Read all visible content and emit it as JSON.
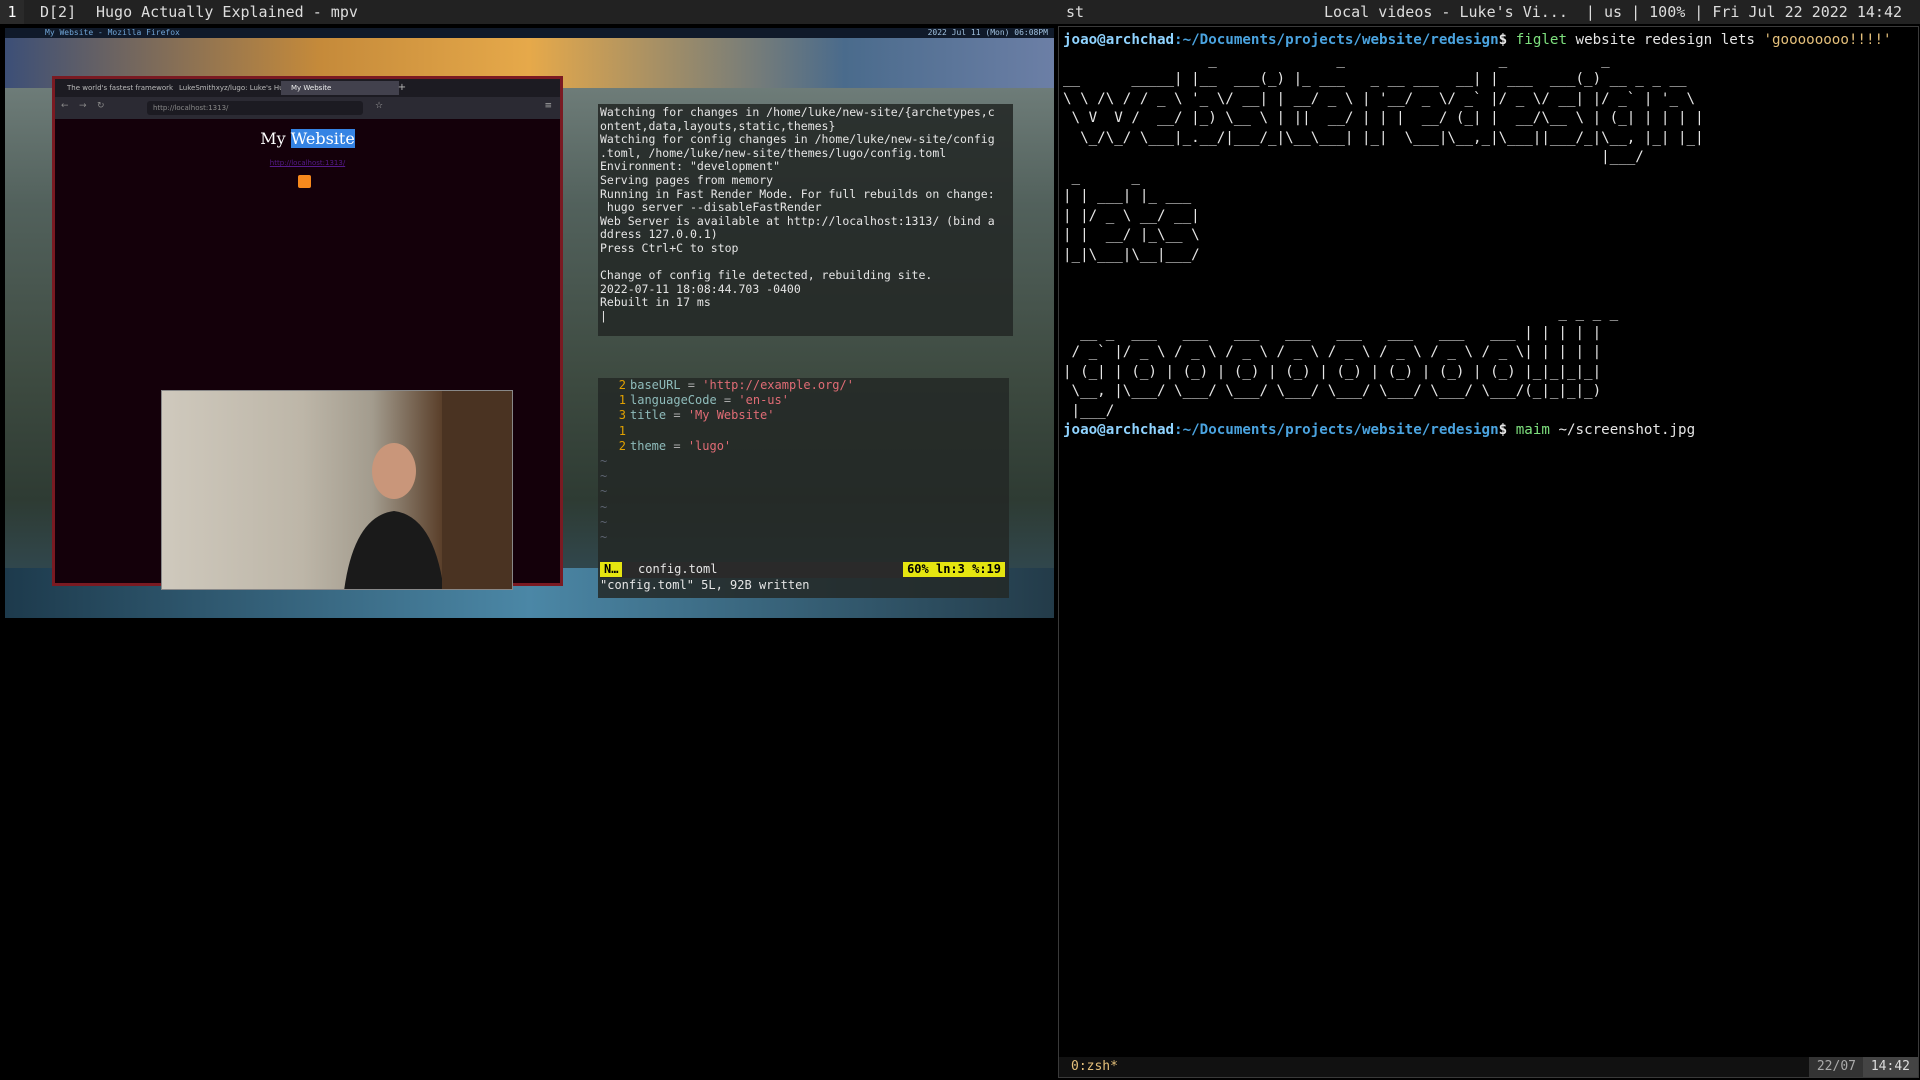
{
  "topbar": {
    "workspace": "1",
    "layout": "D[2]",
    "left_title": "Hugo Actually Explained - mpv",
    "right_title": "st",
    "status": "Local videos - Luke's Vi...  | us | 100% | Fri Jul 22 2022 14:42"
  },
  "mpv": {
    "inner_title": "My Website - Mozilla Firefox",
    "inner_status": "2022 Jul 11 (Mon) 06:08PM"
  },
  "firefox": {
    "tabs": [
      {
        "label": "The world's fastest framework"
      },
      {
        "label": "LukeSmithxyz/lugo: Luke's Hu"
      },
      {
        "label": "My Website"
      }
    ],
    "url": "http://localhost:1313/",
    "page_title_plain": "My",
    "page_title_selected": "Website",
    "page_link": "http://localhost:1313/"
  },
  "hugo_terminal": {
    "lines": [
      "Watching for changes in /home/luke/new-site/{archetypes,c",
      "ontent,data,layouts,static,themes}",
      "Watching for config changes in /home/luke/new-site/config",
      ".toml, /home/luke/new-site/themes/lugo/config.toml",
      "Environment: \"development\"",
      "Serving pages from memory",
      "Running in Fast Render Mode. For full rebuilds on change:",
      " hugo server --disableFastRender",
      "Web Server is available at http://localhost:1313/ (bind a",
      "ddress 127.0.0.1)",
      "Press Ctrl+C to stop",
      "",
      "Change of config file detected, rebuilding site.",
      "2022-07-11 18:08:44.703 -0400",
      "Rebuilt in 17 ms",
      "|"
    ]
  },
  "vim": {
    "lines": [
      {
        "num": "2",
        "key": "baseURL",
        "eq": " = ",
        "val": "'http://example.org/'"
      },
      {
        "num": "1",
        "key": "languageCode",
        "eq": " = ",
        "val": "'en-us'"
      },
      {
        "num": "3",
        "key": "title",
        "eq": " = ",
        "val": "'My Website'"
      },
      {
        "num": "1",
        "key": "",
        "eq": "",
        "val": ""
      },
      {
        "num": "2",
        "key": "theme",
        "eq": " = ",
        "val": "'lugo'"
      }
    ],
    "tilde": "~",
    "mode": "N…",
    "filename": "config.toml",
    "position": "60% ln:3 %:19",
    "message": "\"config.toml\" 5L, 92B written"
  },
  "st": {
    "prompt_user": "joao@archchad",
    "prompt_path": ":~/Documents/projects/website/redesign",
    "prompt_dollar": "$",
    "cmd1": "figlet",
    "cmd1_args": " website redesign lets ",
    "cmd1_str": "'goooooooo!!!!'",
    "figlet": [
      "                 _              _                  _           _",
      "__      _____| |__  ___(_) |_ ___   _ __ ___  __| | ___  ___(_) __ _ _ __",
      "\\ \\ /\\ / / _ \\ '_ \\/ __| | __/ _ \\ | '__/ _ \\/ _` |/ _ \\/ __| |/ _` | '_ \\",
      " \\ V  V /  __/ |_) \\__ \\ | ||  __/ | | |  __/ (_| |  __/\\__ \\ | (_| | | | |",
      "  \\_/\\_/ \\___|_.__/|___/_|\\__\\___| |_|  \\___|\\__,_|\\___||___/_|\\__, |_| |_|",
      "                                                               |___/",
      " _      _",
      "| | ___| |_ ___",
      "| |/ _ \\ __/ __|",
      "| |  __/ |_\\__ \\",
      "|_|\\___|\\__|___/",
      "",
      "",
      "                                                          _ _ _ _",
      "  __ _  ___   ___   ___   ___   ___   ___   ___   ___ | | | | |",
      " / _` |/ _ \\ / _ \\ / _ \\ / _ \\ / _ \\ / _ \\ / _ \\ / _ \\| | | | |",
      "| (_| | (_) | (_) | (_) | (_) | (_) | (_) | (_) | (_) |_|_|_|_|",
      " \\__, |\\___/ \\___/ \\___/ \\___/ \\___/ \\___/ \\___/ \\___/(_|_|_|_)",
      " |___/"
    ],
    "cmd2": "maim",
    "cmd2_args": " ~/screenshot.jpg",
    "tmux_window": "0:zsh*",
    "tmux_date": "22/07",
    "tmux_time": "14:42"
  }
}
